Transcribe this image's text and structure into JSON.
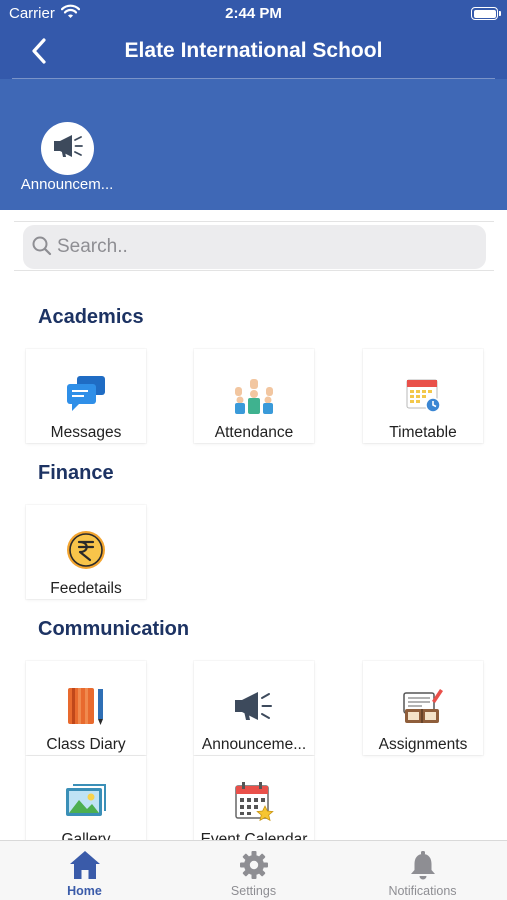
{
  "status_bar": {
    "carrier": "Carrier",
    "time": "2:44 PM"
  },
  "header": {
    "title": "Elate International School",
    "back_icon": "chevron-left-icon"
  },
  "quick_access": [
    {
      "label": "Announcem...",
      "icon": "megaphone-icon"
    }
  ],
  "search": {
    "placeholder": "Search..",
    "value": ""
  },
  "sections": [
    {
      "title": "Academics",
      "items": [
        {
          "label": "Messages",
          "icon": "chat-bubbles-icon"
        },
        {
          "label": "Attendance",
          "icon": "raised-hands-icon"
        },
        {
          "label": "Timetable",
          "icon": "calendar-clock-icon"
        }
      ]
    },
    {
      "title": "Finance",
      "items": [
        {
          "label": "Feedetails",
          "icon": "rupee-coin-icon"
        }
      ]
    },
    {
      "title": "Communication",
      "items": [
        {
          "label": "Class Diary",
          "icon": "notebook-pen-icon"
        },
        {
          "label": "Announceme...",
          "icon": "megaphone-icon"
        },
        {
          "label": "Assignments",
          "icon": "books-pencil-icon"
        },
        {
          "label": "Gallery",
          "icon": "landscape-picture-icon"
        },
        {
          "label": "Event Calendar",
          "icon": "calendar-star-icon"
        }
      ]
    }
  ],
  "tab_bar": {
    "active": "Home",
    "tabs": [
      {
        "label": "Home",
        "icon": "home-icon"
      },
      {
        "label": "Settings",
        "icon": "gear-icon"
      },
      {
        "label": "Notifications",
        "icon": "bell-icon"
      }
    ]
  },
  "colors": {
    "header_bar": "#3459ab",
    "header_panel": "#3f68b6",
    "section_title": "#1d3363",
    "tab_active": "#3a5ba9",
    "tab_inactive": "#8e8e93"
  }
}
